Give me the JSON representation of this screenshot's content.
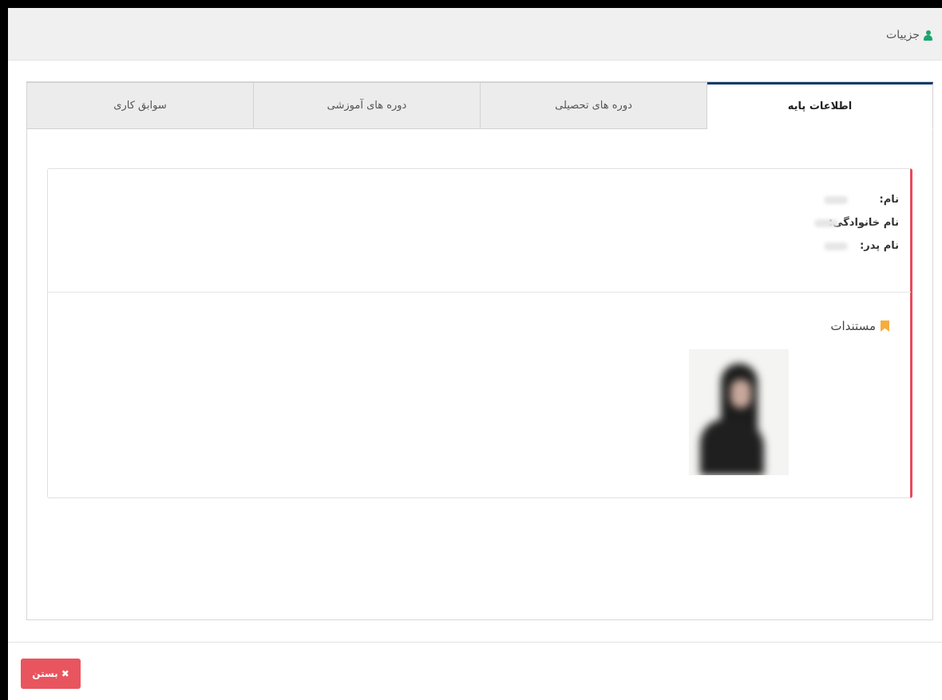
{
  "header": {
    "title": "جزییات",
    "icon": "user-icon"
  },
  "tabs": [
    {
      "label": "اطلاعات پایه",
      "active": true
    },
    {
      "label": "دوره های تحصیلی",
      "active": false
    },
    {
      "label": "دوره های آموزشی",
      "active": false
    },
    {
      "label": "سوابق کاری",
      "active": false
    }
  ],
  "info": {
    "first_name_label": "نام:",
    "last_name_label": "نام خانوادگی:",
    "father_name_label": "نام پدر:"
  },
  "documents": {
    "title": "مستندات",
    "icon": "bookmark-icon"
  },
  "footer": {
    "close_label": "بستن",
    "close_icon": "close-icon"
  },
  "colors": {
    "accent_red": "#e8495e",
    "active_tab_border": "#0e3a6b",
    "user_icon": "#1ca56e",
    "bookmark": "#f6ad3d",
    "close_button": "#e8555f"
  }
}
